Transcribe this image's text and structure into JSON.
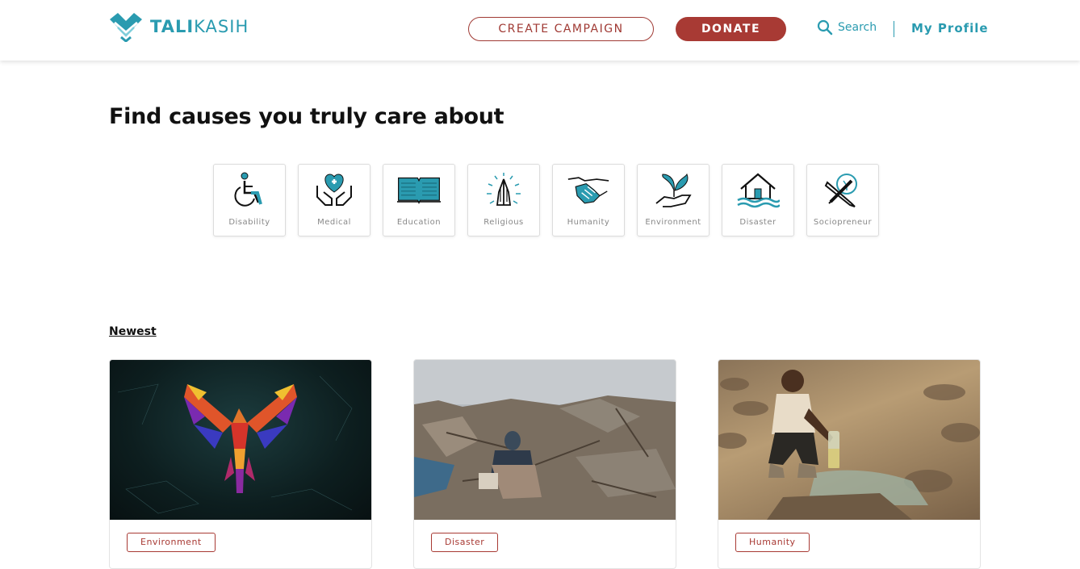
{
  "header": {
    "logo_bold": "TALI",
    "logo_light": "KASIH",
    "create_label": "CREATE CAMPAIGN",
    "donate_label": "DONATE",
    "search_label": "Search",
    "profile_label": "My Profile"
  },
  "hero": {
    "title": "Find causes you truly care about"
  },
  "categories": [
    {
      "label": "Disability",
      "icon": "wheelchair-icon"
    },
    {
      "label": "Medical",
      "icon": "heart-hands-icon"
    },
    {
      "label": "Education",
      "icon": "open-book-icon"
    },
    {
      "label": "Religious",
      "icon": "praying-hands-icon"
    },
    {
      "label": "Humanity",
      "icon": "handshake-icon"
    },
    {
      "label": "Environment",
      "icon": "plant-hand-icon"
    },
    {
      "label": "Disaster",
      "icon": "flooded-house-icon"
    },
    {
      "label": "Sociopreneur",
      "icon": "pencil-bulb-icon"
    }
  ],
  "section": {
    "newest_label": "Newest"
  },
  "campaigns": [
    {
      "tag": "Environment",
      "image": "parrot-artwork"
    },
    {
      "tag": "Disaster",
      "image": "earthquake-rubble-photo"
    },
    {
      "tag": "Humanity",
      "image": "child-water-photo"
    }
  ],
  "colors": {
    "brand_teal": "#2a9bb0",
    "brand_red": "#a83a34"
  }
}
